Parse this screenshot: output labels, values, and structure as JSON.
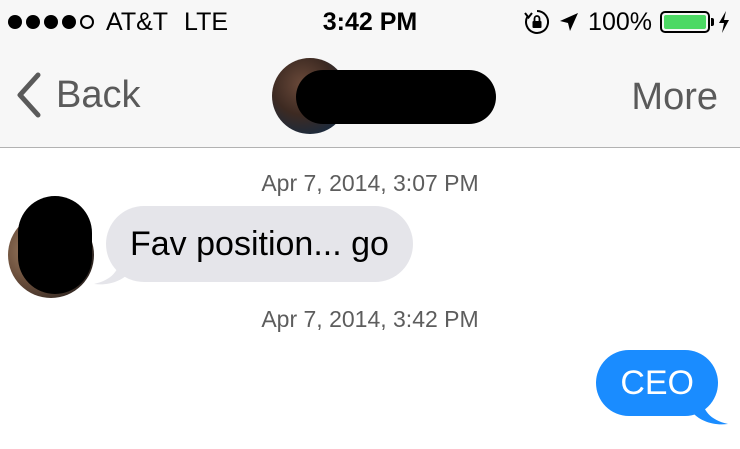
{
  "status_bar": {
    "carrier": "AT&T",
    "network": "LTE",
    "time": "3:42 PM",
    "battery_percent": "100%",
    "battery_level": 1.0,
    "signal_bars_filled": 4,
    "signal_bars_total": 5,
    "icons": [
      "orientation-lock-icon",
      "location-arrow-icon",
      "battery-icon",
      "charging-bolt-icon"
    ]
  },
  "nav_bar": {
    "back_label": "Back",
    "more_label": "More"
  },
  "conversation": {
    "messages": [
      {
        "timestamp": "Apr 7, 2014, 3:07 PM",
        "direction": "incoming",
        "text": "Fav position... go"
      },
      {
        "timestamp": "Apr 7, 2014, 3:42 PM",
        "direction": "outgoing",
        "text": "CEO"
      }
    ]
  },
  "colors": {
    "incoming_bubble": "#e5e5ea",
    "outgoing_bubble": "#1a8cff",
    "battery_fill": "#4cd964",
    "nav_background": "#f7f7f7"
  }
}
